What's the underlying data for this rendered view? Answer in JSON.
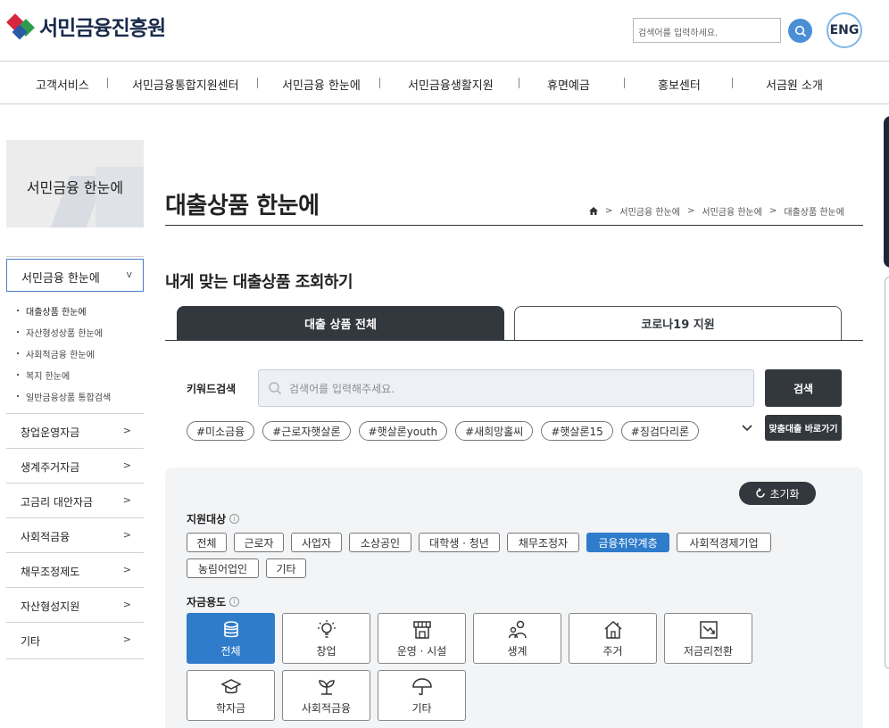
{
  "header": {
    "logo_text": "서민금융진흥원",
    "search_placeholder": "검색어를 입력하세요.",
    "eng_label": "ENG"
  },
  "gnb": [
    "고객서비스",
    "서민금융통합지원센터",
    "서민금융 한눈에",
    "서민금융생활지원",
    "휴면예금",
    "홍보센터",
    "서금원 소개"
  ],
  "sidebar": {
    "banner_title": "서민금융 한눈에",
    "active_menu": "서민금융 한눈에",
    "active_chevron": "v",
    "sub_items": [
      "대출상품 한눈에",
      "자산형성상품 한눈에",
      "사회적금융 한눈에",
      "복지 한눈에",
      "일반금융상품 통합검색"
    ],
    "items": [
      "창업운영자금",
      "생계주거자금",
      "고금리 대안자금",
      "사회적금융",
      "채무조정제도",
      "자산형성지원",
      "기타"
    ]
  },
  "page": {
    "title": "대출상품 한눈에",
    "breadcrumb": [
      "서민금융 한눈에",
      "서민금융 한눈에",
      "대출상품 한눈에"
    ],
    "section_title": "내게 맞는 대출상품 조회하기",
    "tabs": [
      "대출 상품 전체",
      "코로나19 지원"
    ]
  },
  "keyword": {
    "label": "키워드검색",
    "placeholder": "검색어를 입력해주세요.",
    "search_button": "검색",
    "tags": [
      "#미소금융",
      "#근로자햇살론",
      "#햇살론youth",
      "#새희망홀씨",
      "#햇살론15",
      "#징검다리론"
    ],
    "match_button": "맞춤대출 바로가기"
  },
  "filters": {
    "reset": "초기화",
    "target_label": "지원대상",
    "targets": [
      "전체",
      "근로자",
      "사업자",
      "소상공인",
      "대학생 · 청년",
      "채무조정자",
      "금융취약계층",
      "사회적경제기업",
      "농림어업인",
      "기타"
    ],
    "target_selected": "금융취약계층",
    "use_label": "자금용도",
    "uses": [
      "전체",
      "창업",
      "운영 · 시설",
      "생계",
      "주거",
      "저금리전환",
      "학자금",
      "사회적금융",
      "기타"
    ],
    "use_selected": "전체"
  },
  "colors": {
    "accent": "#2f7ccb",
    "dark": "#33373e"
  }
}
